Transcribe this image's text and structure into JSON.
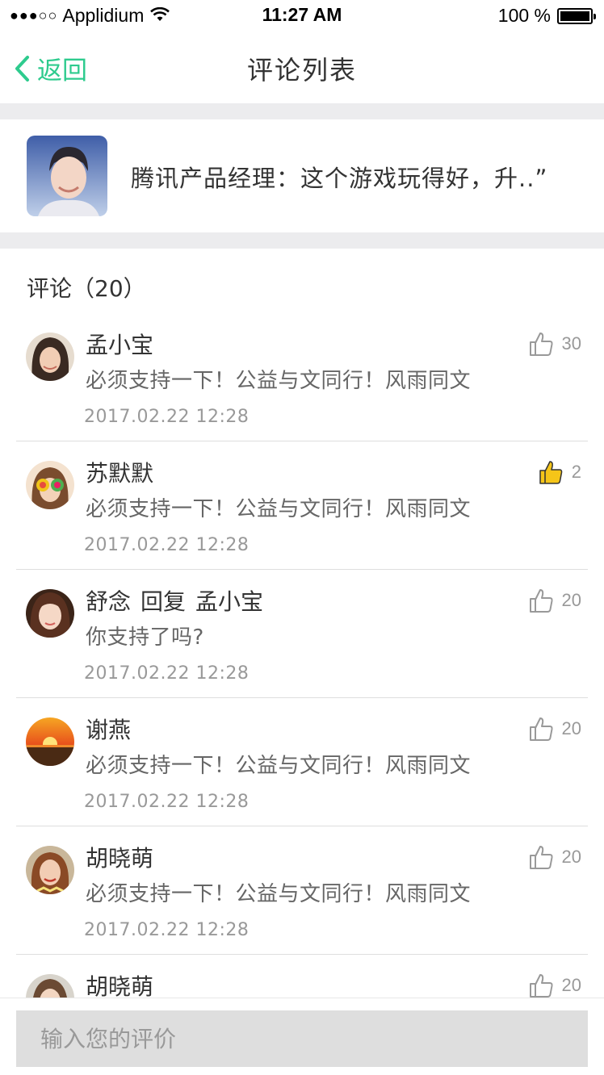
{
  "status_bar": {
    "carrier": "Applidium",
    "time": "11:27 AM",
    "battery": "100 %"
  },
  "nav": {
    "back_label": "返回",
    "title": "评论列表"
  },
  "article": {
    "text": "腾讯产品经理：这个游戏玩得好，升..”"
  },
  "comments_header": "评论（20）",
  "comments": [
    {
      "name": "孟小宝",
      "body": "必须支持一下！公益与文同行！风雨同文",
      "time": "2017.02.22   12:28",
      "likes": "30",
      "liked": false
    },
    {
      "name": "苏默默",
      "body": "必须支持一下！公益与文同行！风雨同文",
      "time": "2017.02.22   12:28",
      "likes": "2",
      "liked": true
    },
    {
      "name": "舒念",
      "reply_word": "回复",
      "reply_to": "孟小宝",
      "body": "你支持了吗?",
      "time": "2017.02.22   12:28",
      "likes": "20",
      "liked": false
    },
    {
      "name": "谢燕",
      "body": "必须支持一下！公益与文同行！风雨同文",
      "time": "2017.02.22   12:28",
      "likes": "20",
      "liked": false
    },
    {
      "name": "胡晓萌",
      "body": "必须支持一下！公益与文同行！风雨同文",
      "time": "2017.02.22   12:28",
      "likes": "20",
      "liked": false
    },
    {
      "name": "胡晓萌",
      "likes": "20",
      "liked": false
    }
  ],
  "input": {
    "placeholder": "输入您的评价"
  },
  "colors": {
    "accent": "#2ecb8e",
    "text_primary": "#333333",
    "text_secondary": "#666666",
    "text_meta": "#999999",
    "liked": "#f5c518"
  }
}
